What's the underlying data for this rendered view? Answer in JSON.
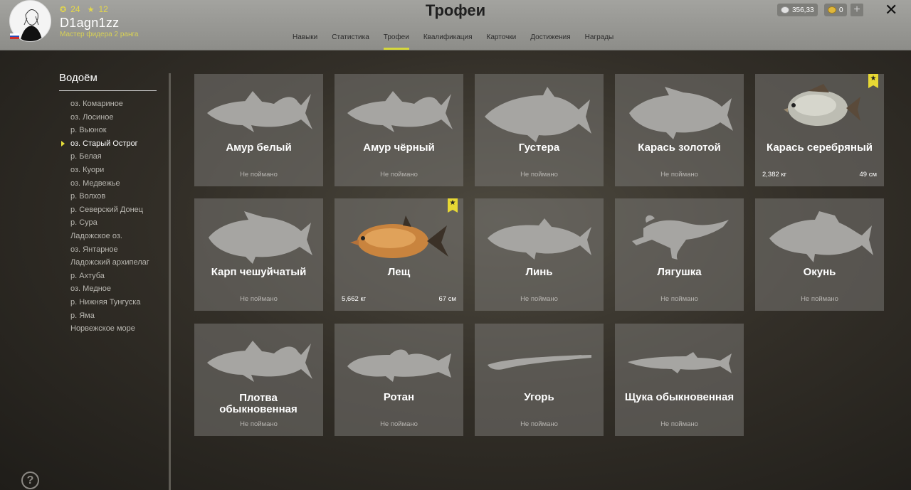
{
  "header": {
    "title": "Трофеи",
    "player": {
      "level": "24",
      "stars": "12",
      "username": "D1agn1zz",
      "rank": "Мастер фидера 2 ранга"
    },
    "tabs": [
      {
        "label": "Навыки"
      },
      {
        "label": "Статистика"
      },
      {
        "label": "Трофеи",
        "active": true
      },
      {
        "label": "Квалификация"
      },
      {
        "label": "Карточки"
      },
      {
        "label": "Достижения"
      },
      {
        "label": "Награды"
      }
    ],
    "silver": "356,33",
    "gold": "0"
  },
  "sidebar": {
    "title": "Водоём",
    "items": [
      "оз. Комариное",
      "оз. Лосиное",
      "р. Вьюнок",
      "оз. Старый Острог",
      "р. Белая",
      "оз. Куори",
      "оз. Медвежье",
      "р. Волхов",
      "р. Северский Донец",
      "р. Сура",
      "Ладожское оз.",
      "оз. Янтарное",
      "Ладожский архипелаг",
      "р. Ахтуба",
      "оз. Медное",
      "р. Нижняя Тунгуска",
      "р. Яма",
      "Норвежское море"
    ],
    "selected_index": 3
  },
  "trophies": [
    {
      "name": "Амур белый",
      "status": "Не поймано"
    },
    {
      "name": "Амур чёрный",
      "status": "Не поймано"
    },
    {
      "name": "Густера",
      "status": "Не поймано"
    },
    {
      "name": "Карась золотой",
      "status": "Не поймано"
    },
    {
      "name": "Карась серебряный",
      "weight": "2,382 кг",
      "length": "49 см"
    },
    {
      "name": "Карп чешуйчатый",
      "status": "Не поймано"
    },
    {
      "name": "Лещ",
      "weight": "5,662 кг",
      "length": "67 см"
    },
    {
      "name": "Линь",
      "status": "Не поймано"
    },
    {
      "name": "Лягушка",
      "status": "Не поймано"
    },
    {
      "name": "Окунь",
      "status": "Не поймано"
    },
    {
      "name": "Плотва обыкновенная",
      "status": "Не поймано"
    },
    {
      "name": "Ротан",
      "status": "Не поймано"
    },
    {
      "name": "Угорь",
      "status": "Не поймано"
    },
    {
      "name": "Щука обыкновенная",
      "status": "Не поймано"
    }
  ],
  "colors": {
    "accent": "#e7d834",
    "silhouette": "#a6a5a2",
    "card_bg": "#67655f"
  }
}
